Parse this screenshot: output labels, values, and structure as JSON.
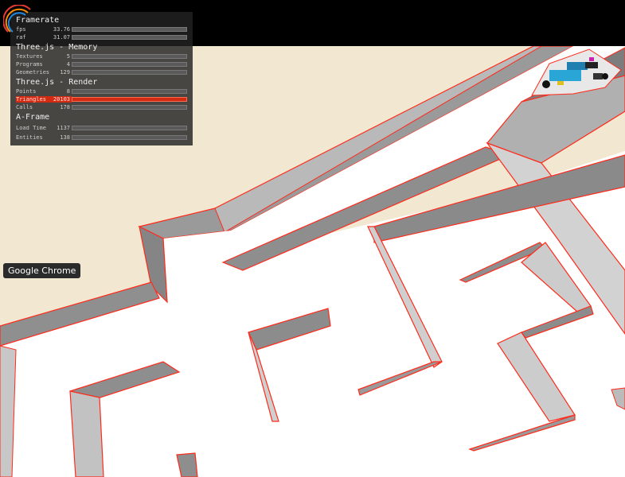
{
  "stats": {
    "framerate_title": "Framerate",
    "memory_title": "Three.js - Memory",
    "render_title": "Three.js - Render",
    "aframe_title": "A-Frame",
    "framerate_rows": [
      {
        "label": "fps",
        "value": "33.76"
      },
      {
        "label": "raf",
        "value": "31.07"
      }
    ],
    "memory_rows": [
      {
        "label": "Textures",
        "value": "5"
      },
      {
        "label": "Programs",
        "value": "4"
      },
      {
        "label": "Geometries",
        "value": "129"
      }
    ],
    "render_rows": [
      {
        "label": "Points",
        "value": "8"
      },
      {
        "label": "Triangles",
        "value": "20103"
      },
      {
        "label": "Calls",
        "value": "178"
      }
    ],
    "aframe_rows": [
      {
        "label": "Load Time",
        "value": "1137"
      },
      {
        "label": "Entities",
        "value": "138"
      }
    ]
  },
  "tooltip": {
    "text": "Google Chrome"
  },
  "colors": {
    "floor": "#ffffff",
    "ground": "#f2e8d2",
    "wall_side": "#8c8c8c",
    "wall_edge": "#ff2a1a",
    "alarm": "#d32a12"
  },
  "icons": {
    "framerate_logo": "chrome-logo-rings-icon",
    "robot": "robot-vehicle-icon"
  }
}
